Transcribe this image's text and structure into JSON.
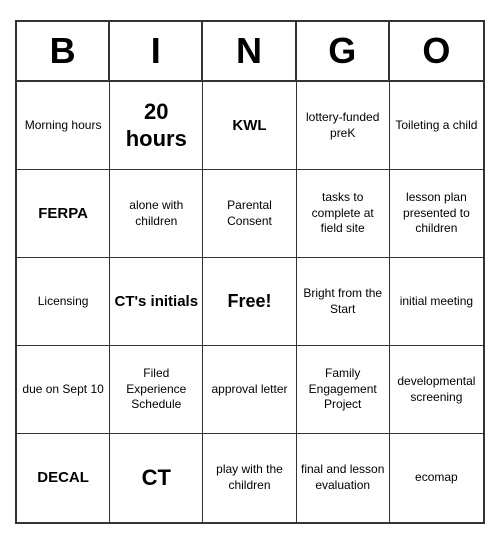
{
  "header": {
    "letters": [
      "B",
      "I",
      "N",
      "G",
      "O"
    ]
  },
  "cells": [
    {
      "text": "Morning hours",
      "size": "normal"
    },
    {
      "text": "20 hours",
      "size": "large"
    },
    {
      "text": "KWL",
      "size": "medium"
    },
    {
      "text": "lottery-funded preK",
      "size": "normal"
    },
    {
      "text": "Toileting a child",
      "size": "normal"
    },
    {
      "text": "FERPA",
      "size": "medium"
    },
    {
      "text": "alone with children",
      "size": "normal"
    },
    {
      "text": "Parental Consent",
      "size": "normal"
    },
    {
      "text": "tasks to complete at field site",
      "size": "small"
    },
    {
      "text": "lesson plan presented to children",
      "size": "small"
    },
    {
      "text": "Licensing",
      "size": "normal"
    },
    {
      "text": "CT's initials",
      "size": "medium"
    },
    {
      "text": "Free!",
      "size": "free"
    },
    {
      "text": "Bright from the Start",
      "size": "normal"
    },
    {
      "text": "initial meeting",
      "size": "normal"
    },
    {
      "text": "due on Sept 10",
      "size": "normal"
    },
    {
      "text": "Filed Experience Schedule",
      "size": "small"
    },
    {
      "text": "approval letter",
      "size": "normal"
    },
    {
      "text": "Family Engagement Project",
      "size": "small"
    },
    {
      "text": "developmental screening",
      "size": "small"
    },
    {
      "text": "DECAL",
      "size": "medium"
    },
    {
      "text": "CT",
      "size": "large"
    },
    {
      "text": "play with the children",
      "size": "normal"
    },
    {
      "text": "final and lesson evaluation",
      "size": "small"
    },
    {
      "text": "ecomap",
      "size": "normal"
    }
  ]
}
